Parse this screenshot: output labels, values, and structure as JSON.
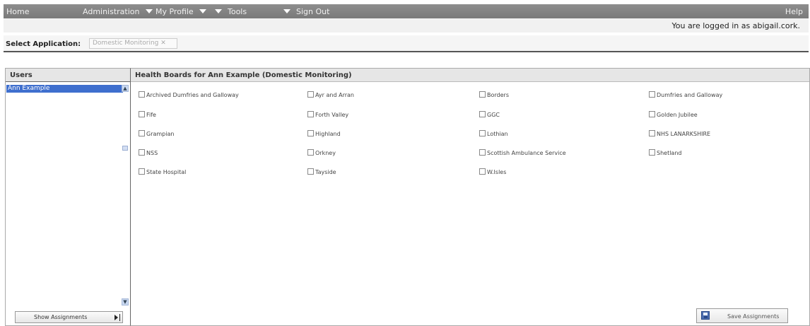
{
  "nav": {
    "home": "Home",
    "administration": "Administration",
    "my_profile": "My Profile",
    "tools": "Tools",
    "sign_out": "Sign Out",
    "help": "Help",
    "logged_in": "You are logged in as abigail.cork."
  },
  "app_select": {
    "label": "Select Application:",
    "value": "Domestic Monitoring"
  },
  "users": {
    "header": "Users",
    "items": [
      "Ann Example"
    ],
    "show_assignments": "Show Assignments"
  },
  "boards": {
    "header": "Health Boards for Ann Example (Domestic Monitoring)",
    "items": [
      "Archived Dumfries and Galloway",
      "Ayr and Arran",
      "Borders",
      "Dumfries and Galloway",
      "Fife",
      "Forth Valley",
      "GGC",
      "Golden Jubilee",
      "Grampian",
      "Highland",
      "Lothian",
      "NHS LANARKSHIRE",
      "NSS",
      "Orkney",
      "Scottish Ambulance Service",
      "Shetland",
      "State Hospital",
      "Tayside",
      "W.Isles"
    ],
    "save_label": "Save Assignments"
  },
  "colors": {
    "nav_bg": "#7a7a7a",
    "selected_user": "#3f6fce"
  },
  "icons": [
    "chevron-down-icon",
    "scroll-up-icon",
    "scroll-down-icon",
    "play-icon",
    "save-icon",
    "checkbox-icon"
  ]
}
